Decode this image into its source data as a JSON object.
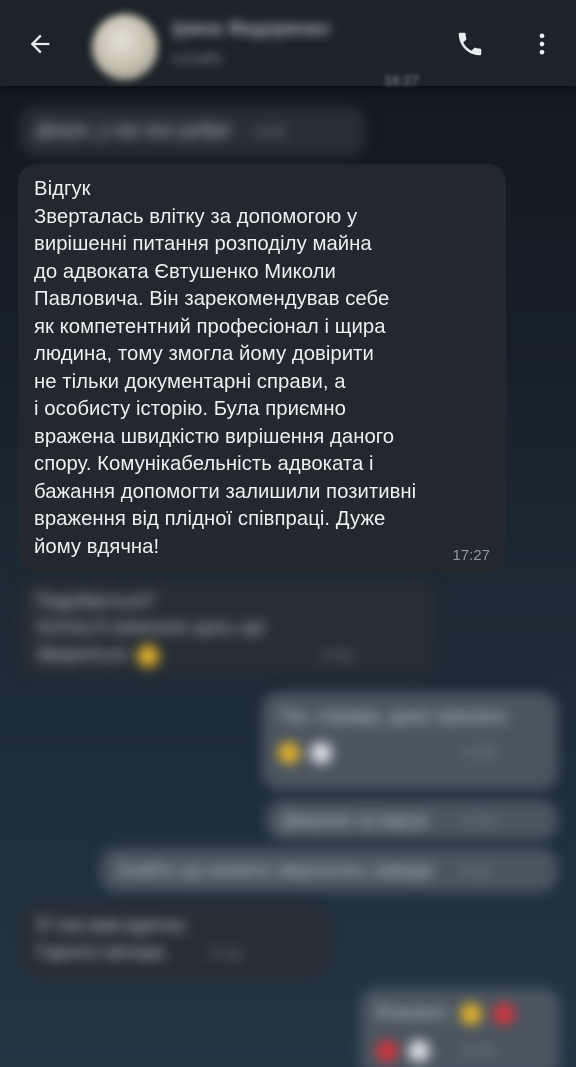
{
  "header": {
    "contact_name": "Ірина Федоренко",
    "contact_status": "онлайн",
    "back_icon": "arrow-left-icon",
    "call_icon": "phone-icon",
    "menu_icon": "more-vertical-icon"
  },
  "stray_time": "16:27",
  "messages": {
    "blur1": {
      "text": "Дякую, у нас все добре",
      "time": "16:28"
    },
    "review": {
      "text": "Відгук\nЗверталась влітку за допомогою у\nвирішенні питання розподілу майна\nдо адвоката Євтушенко Миколи\nПавловича. Він зарекомендував себе\nяк компетентний професіонал і щира\nлюдина, тому змогла йому довірити\nне тільки документарні справи, а\nі особисту історію. Була приємно\nвражена швидкістю вирішення даного\nспору. Комунікабельність адвоката і\nбажання допомогти залишили позитивні\nвраження від плідної співпраці. Дуже\nйому вдячна!",
      "time": "17:27"
    },
    "blur2": {
      "line1": "Подобається?",
      "line2": "Хотіла б написати щось ще",
      "line3": "Зверніться",
      "time": "17:29"
    },
    "blur3": {
      "text": "Так, справді, дуже приємно",
      "time": "17:30"
    },
    "blur4": {
      "text": "Дякуємо за відгук",
      "time": "17:31"
    },
    "blur5": {
      "text": "Знайте що можете звертатись завжди",
      "time": "17:31"
    },
    "blur6": {
      "line1": "Я теж вам вдячна",
      "line2": "Гарного вечора",
      "time": "17:33"
    },
    "blur7": {
      "text": "Взаємно",
      "time": "17:34"
    }
  },
  "colors": {
    "background": "#17212a",
    "incoming_bubble": "#22282d",
    "outgoing_bubble": "#4a5560",
    "text": "#eef1f3",
    "timestamp": "#8e989f"
  }
}
